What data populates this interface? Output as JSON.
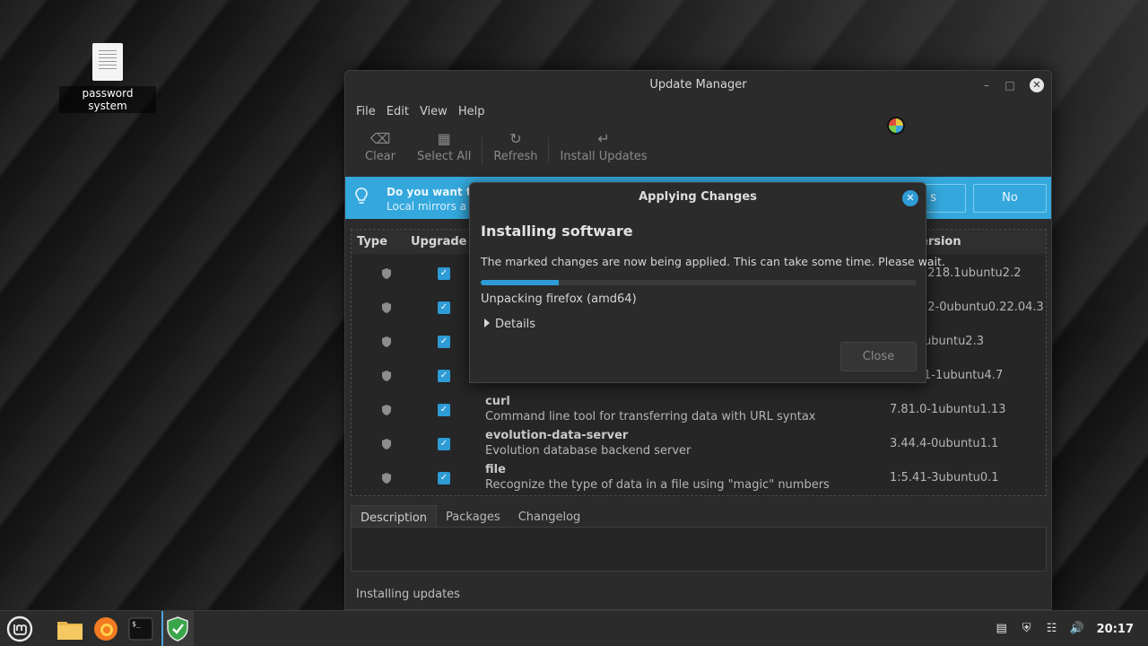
{
  "desktop": {
    "icon_label": "password system"
  },
  "window": {
    "title": "Update Manager",
    "menu": [
      "File",
      "Edit",
      "View",
      "Help"
    ],
    "toolbar": {
      "clear": "Clear",
      "select_all": "Select All",
      "refresh": "Refresh",
      "install": "Install Updates"
    },
    "infobar": {
      "title": "Do you want to",
      "subtitle": "Local mirrors a",
      "yes_label": "s",
      "no_label": "No",
      "color": "#34a8dd"
    },
    "table": {
      "headers": [
        "Type",
        "Upgrade",
        "ersion"
      ],
      "rows": [
        {
          "name": "",
          "desc": "",
          "version": "1218.1ubuntu2.2"
        },
        {
          "name": "",
          "desc": "",
          "version": "12-0ubuntu0.22.04.3"
        },
        {
          "name": "",
          "desc": "",
          "version": "ubuntu2.3"
        },
        {
          "name": "",
          "desc": "",
          "version": "1-1ubuntu4.7"
        },
        {
          "name": "curl",
          "desc": "Command line tool for transferring data with URL syntax",
          "version": "7.81.0-1ubuntu1.13"
        },
        {
          "name": "evolution-data-server",
          "desc": "Evolution database backend server",
          "version": "3.44.4-0ubuntu1.1"
        },
        {
          "name": "file",
          "desc": "Recognize the type of data in a file using \"magic\" numbers",
          "version": "1:5.41-3ubuntu0.1"
        }
      ]
    },
    "tabs": [
      "Description",
      "Packages",
      "Changelog"
    ],
    "status": "Installing updates"
  },
  "dialog": {
    "title": "Applying Changes",
    "heading": "Installing software",
    "message": "The marked changes are now being applied. This can take some time. Please wait.",
    "progress": 0.18,
    "status": "Unpacking firefox (amd64)",
    "details_label": "Details",
    "close_label": "Close",
    "accent": "#2e9bd6"
  },
  "taskbar": {
    "clock": "20:17",
    "icons": [
      "mint-menu-icon",
      "files-icon",
      "firefox-icon",
      "terminal-icon",
      "update-manager-icon"
    ]
  }
}
